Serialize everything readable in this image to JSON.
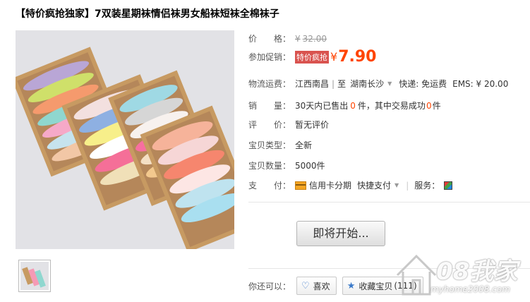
{
  "title": "【特价疯抢独家】7双装星期袜情侣袜男女船袜短袜全棉袜子",
  "price": {
    "label": "价　　格：",
    "currency": "¥",
    "original": "32.00"
  },
  "promo": {
    "label": "参加促销：",
    "tag": "特价疯抢",
    "currency": "¥",
    "price": "7.90"
  },
  "shipping": {
    "label": "物流运费：",
    "from": "江西南昌",
    "separator": "|",
    "to_prefix": "至",
    "to": "湖南长沙",
    "express": "快递: 免运费",
    "ems": "EMS: ¥ 20.00"
  },
  "sales": {
    "label": "销　　量：",
    "prefix": "30天内已售出",
    "sold": "0",
    "unit1": "件，其中交易成功",
    "success": "0",
    "unit2": "件"
  },
  "rating": {
    "label": "评　　价：",
    "value": "暂无评价"
  },
  "type": {
    "label": "宝贝类型：",
    "value": "全新"
  },
  "quantity": {
    "label": "宝贝数量：",
    "value": "5000件"
  },
  "payment": {
    "label": "支　　付：",
    "card": "信用卡分期",
    "quick": "快捷支付",
    "service_label": "服务："
  },
  "start_button": "即将开始...",
  "also": {
    "label": "你还可以：",
    "like": "喜欢",
    "collect": "收藏宝贝",
    "collect_count": "(111)"
  },
  "watermark": {
    "text": "08我家",
    "url": "myhome2008.com"
  },
  "colors": {
    "accent": "#ff4400",
    "promo_tag": "#d9534f",
    "link_icon": "#3a79c9"
  }
}
